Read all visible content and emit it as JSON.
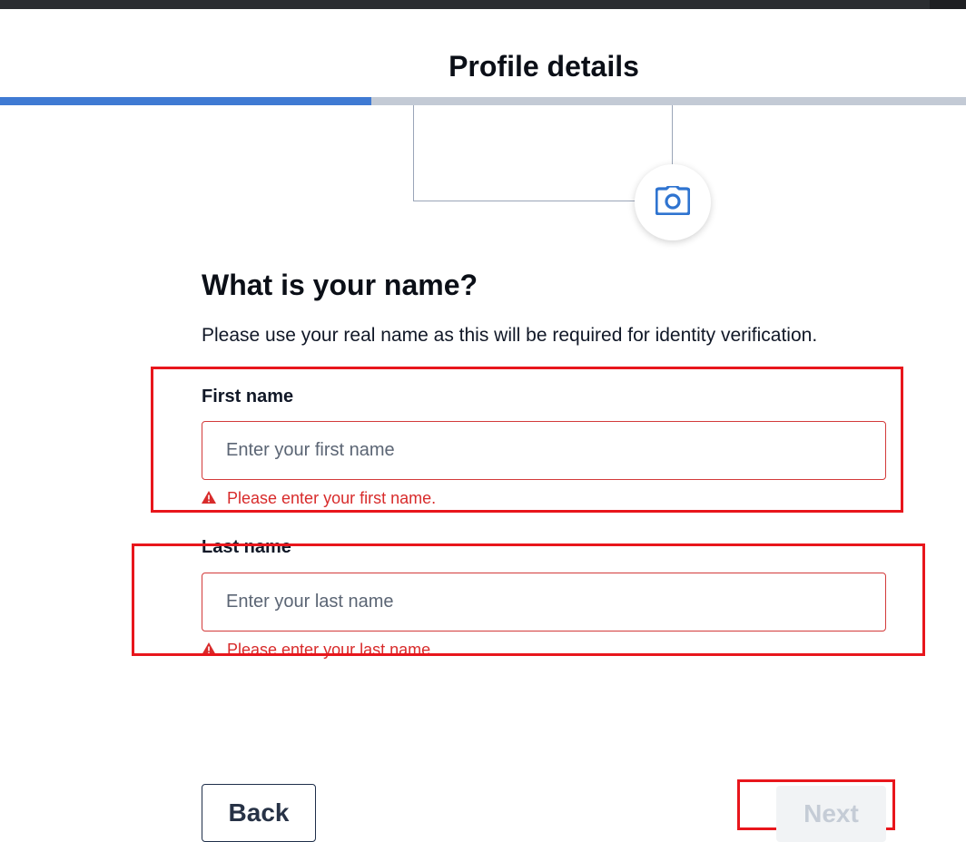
{
  "header": {
    "title": "Profile details"
  },
  "progress": {
    "fraction": 0.384
  },
  "photo": {
    "button_icon": "camera-icon",
    "accent_color": "#2f74d0"
  },
  "form": {
    "question": "What is your name?",
    "subtitle": "Please use your real name as this will be required for identity verification.",
    "first_name": {
      "label": "First name",
      "value": "",
      "placeholder": "Enter your first name",
      "error": "Please enter your first name."
    },
    "last_name": {
      "label": "Last name",
      "value": "",
      "placeholder": "Enter your last name",
      "error": "Please enter your last name."
    }
  },
  "footer": {
    "back_label": "Back",
    "next_label": "Next"
  },
  "colors": {
    "error": "#d82b2b",
    "annotation": "#e8161c",
    "progress": "#3f7ad3"
  }
}
